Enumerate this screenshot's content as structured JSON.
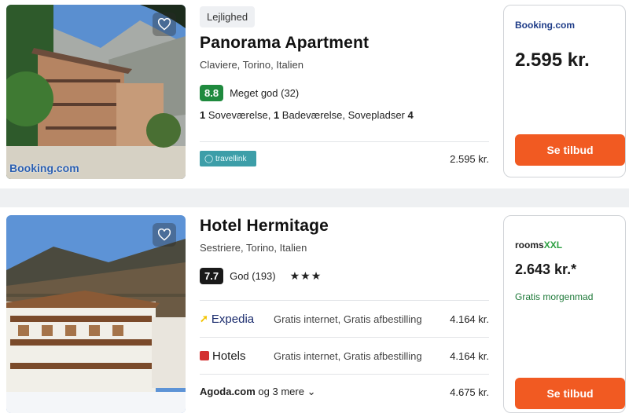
{
  "listings": [
    {
      "type_tag": "Lejlighed",
      "name": "Panorama Apartment",
      "location": "Claviere, Torino, Italien",
      "score": "8.8",
      "score_label": "Meget god (32)",
      "rooms": {
        "bedrooms_num": "1",
        "bedrooms_label": " Soveværelse, ",
        "bathrooms_num": "1",
        "bathrooms_label": " Badeværelse, Sovepladser ",
        "sleeps_num": "4"
      },
      "provider": {
        "name": "travellink",
        "price": "2.595 kr."
      },
      "offer": {
        "brand": "Booking.com",
        "price": "2.595 kr.",
        "cta": "Se tilbud"
      },
      "photo_watermark": "Booking.com"
    },
    {
      "name": "Hotel Hermitage",
      "location": "Sestriere, Torino, Italien",
      "score": "7.7",
      "score_label": "God (193)",
      "stars": "★★★",
      "providers": [
        {
          "name": "Expedia",
          "amenities": "Gratis internet, Gratis afbestilling",
          "price": "4.164 kr."
        },
        {
          "name": "Hotels",
          "amenities": "Gratis internet, Gratis afbestilling",
          "price": "4.164 kr."
        }
      ],
      "more": {
        "name": "Agoda.com",
        "suffix": " og 3 mere",
        "price": "4.675 kr."
      },
      "offer": {
        "brand_a": "rooms",
        "brand_b": "XXL",
        "price": "2.643 kr.*",
        "perk": "Gratis morgenmad",
        "cta": "Se tilbud"
      }
    }
  ],
  "colors": {
    "accent": "#f15a22",
    "score_green": "#1f8a3e",
    "score_dark": "#1a1a1a"
  },
  "icons": {
    "favorite": "heart-icon",
    "expand": "chevron-down-icon"
  }
}
